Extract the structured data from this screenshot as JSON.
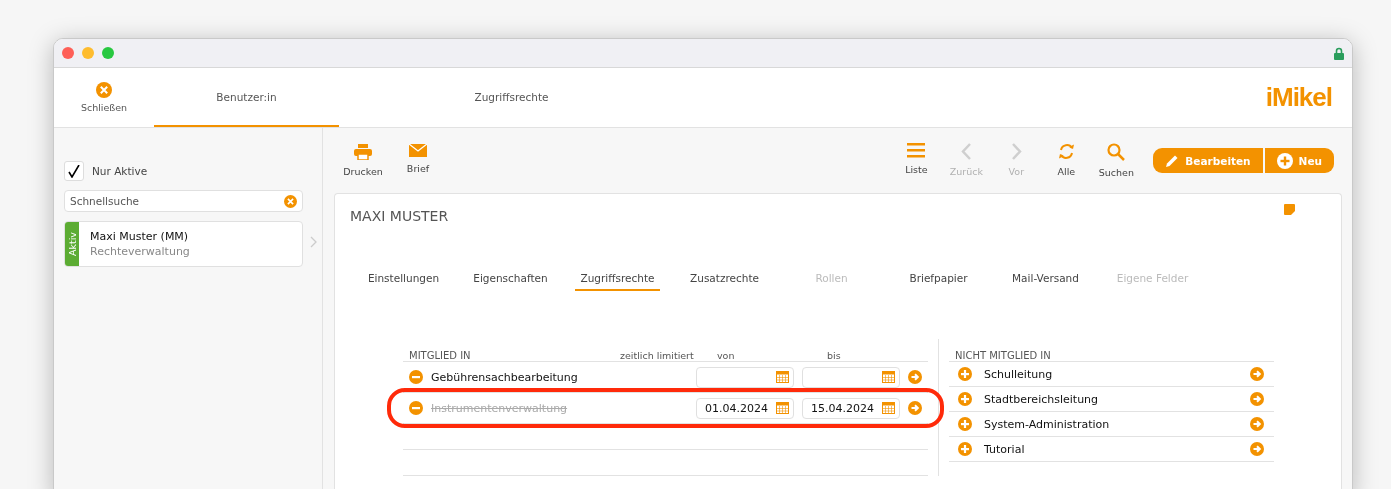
{
  "topbar": {
    "close_label": "Schließen",
    "tabs": [
      {
        "label": "Benutzer:in",
        "selected": true
      },
      {
        "label": "Zugriffsrechte",
        "selected": false
      }
    ],
    "logo": "iMikel"
  },
  "sidebar": {
    "filter": {
      "label": "Nur Aktive",
      "checked": true
    },
    "search": {
      "placeholder": "Schnellsuche"
    },
    "items": [
      {
        "badge": "Aktiv",
        "name": "Maxi Muster (MM)",
        "subtitle": "Rechteverwaltung"
      }
    ]
  },
  "toolbar": {
    "left": [
      {
        "label": "Drucken",
        "kind": "print"
      },
      {
        "label": "Brief",
        "kind": "mail"
      }
    ],
    "right": [
      {
        "label": "Liste",
        "kind": "list",
        "disabled": false
      },
      {
        "label": "Zurück",
        "kind": "back",
        "disabled": true
      },
      {
        "label": "Vor",
        "kind": "forward",
        "disabled": true
      },
      {
        "label": "Alle",
        "kind": "refresh",
        "disabled": false
      },
      {
        "label": "Suchen",
        "kind": "search",
        "disabled": false
      }
    ],
    "buttons": [
      {
        "label": "Bearbeiten",
        "kind": "edit"
      },
      {
        "label": "Neu",
        "kind": "add"
      }
    ]
  },
  "record": {
    "title": "MAXI MUSTER",
    "tabs": [
      {
        "label": "Einstellungen",
        "selected": false,
        "disabled": false
      },
      {
        "label": "Eigenschaften",
        "selected": false,
        "disabled": false
      },
      {
        "label": "Zugriffsrechte",
        "selected": true,
        "disabled": false
      },
      {
        "label": "Zusatzrechte",
        "selected": false,
        "disabled": false
      },
      {
        "label": "Rollen",
        "selected": false,
        "disabled": true
      },
      {
        "label": "Briefpapier",
        "selected": false,
        "disabled": false
      },
      {
        "label": "Mail-Versand",
        "selected": false,
        "disabled": false
      },
      {
        "label": "Eigene Felder",
        "selected": false,
        "disabled": true
      }
    ],
    "member_of": {
      "heading": "MITGLIED IN",
      "col_limited": "zeitlich limitiert",
      "col_from": "von",
      "col_to": "bis",
      "rows": [
        {
          "name": "Gebührensachbearbeitung",
          "inactive": false,
          "highlighted": false
        },
        {
          "name": "Instrumentenverwaltung",
          "inactive": true,
          "highlighted": true,
          "from": "01.04.2024",
          "to": "15.04.2024"
        }
      ]
    },
    "not_member_of": {
      "heading": "NICHT MITGLIED IN",
      "rows": [
        {
          "name": "Schulleitung"
        },
        {
          "name": "Stadtbereichsleitung"
        },
        {
          "name": "System-Administration"
        },
        {
          "name": "Tutorial"
        }
      ]
    }
  }
}
